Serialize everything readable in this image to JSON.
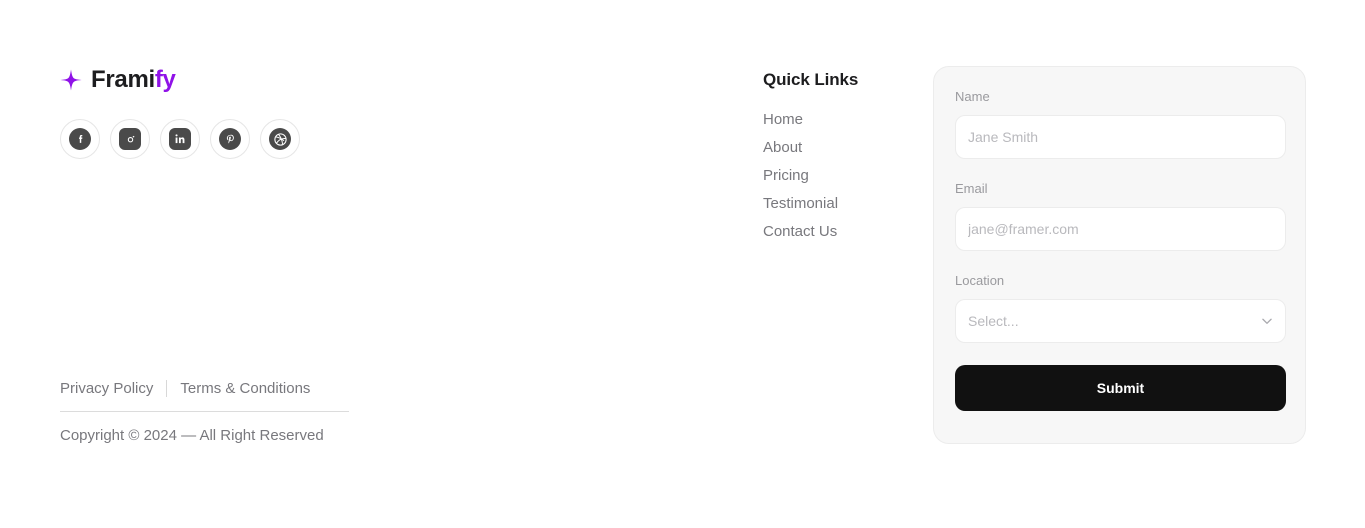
{
  "brand": {
    "logo_icon": "sparkle-icon",
    "name_primary": "Frami",
    "name_accent": "fy",
    "accent_color": "#9012e8",
    "text_color": "#1d1d1f"
  },
  "social": {
    "items": [
      {
        "icon": "facebook-icon",
        "label": "Facebook",
        "shape": "circle"
      },
      {
        "icon": "instagram-icon",
        "label": "Instagram",
        "shape": "square"
      },
      {
        "icon": "linkedin-icon",
        "label": "LinkedIn",
        "shape": "square"
      },
      {
        "icon": "pinterest-icon",
        "label": "Pinterest",
        "shape": "circle"
      },
      {
        "icon": "dribbble-icon",
        "label": "Dribbble",
        "shape": "circle"
      }
    ]
  },
  "quick_links": {
    "title": "Quick Links",
    "items": [
      {
        "label": "Home"
      },
      {
        "label": "About"
      },
      {
        "label": "Pricing"
      },
      {
        "label": "Testimonial"
      },
      {
        "label": "Contact Us"
      }
    ]
  },
  "form": {
    "name": {
      "label": "Name",
      "placeholder": "Jane Smith",
      "value": ""
    },
    "email": {
      "label": "Email",
      "placeholder": "jane@framer.com",
      "value": ""
    },
    "location": {
      "label": "Location",
      "selected": "Select...",
      "chevron_icon": "chevron-down-icon"
    },
    "submit_label": "Submit",
    "submit_bg": "#111111",
    "card_bg": "#f7f7f7"
  },
  "legal": {
    "privacy_label": "Privacy Policy",
    "terms_label": "Terms & Conditions",
    "copyright": "Copyright © 2024 — All Right Reserved"
  }
}
